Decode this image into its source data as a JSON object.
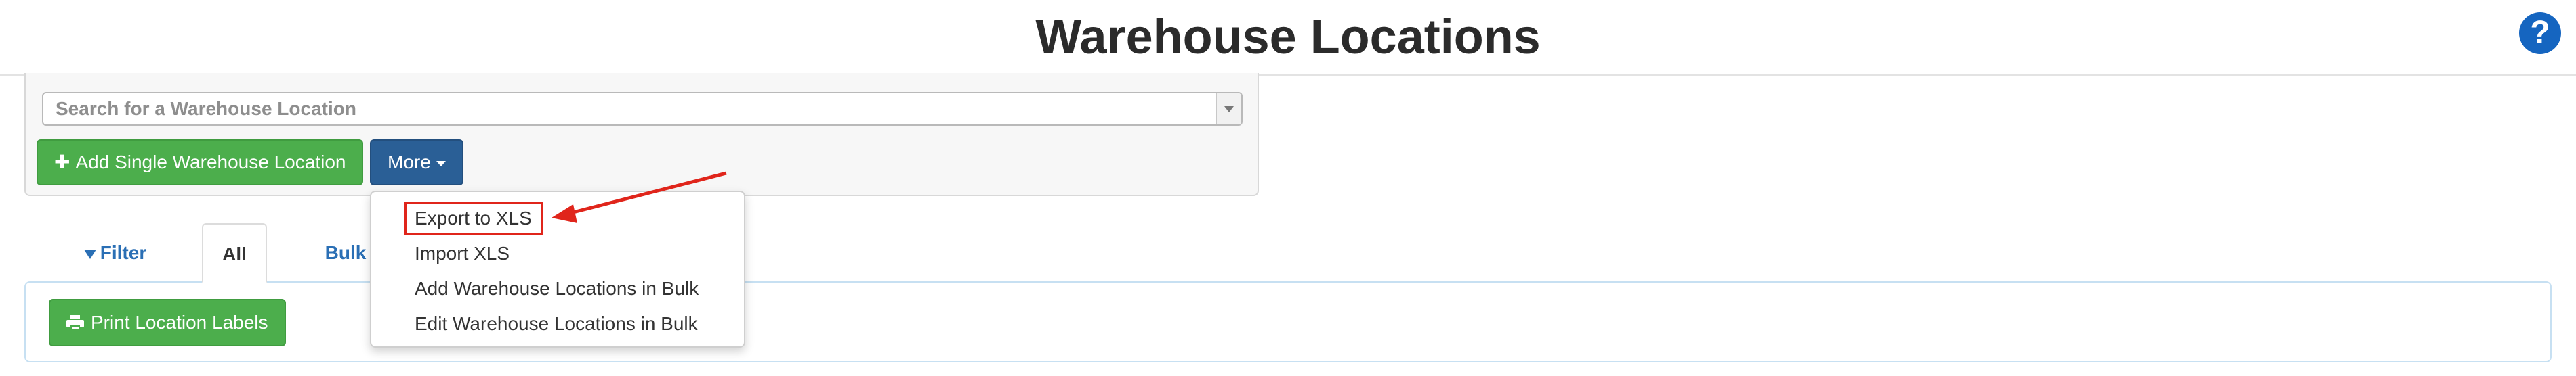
{
  "header": {
    "title": "Warehouse Locations",
    "help_glyph": "?"
  },
  "search": {
    "placeholder": "Search for a Warehouse Location",
    "value": ""
  },
  "toolbar": {
    "add_label": "Add Single Warehouse Location",
    "more_label": "More"
  },
  "tabs": [
    {
      "label": "Filter"
    },
    {
      "label": "All",
      "active": true
    },
    {
      "label": "Bulk"
    }
  ],
  "content": {
    "print_label": "Print Location Labels"
  },
  "dropdown": {
    "items": [
      {
        "label": "Export to XLS",
        "highlighted": true
      },
      {
        "label": "Import XLS"
      },
      {
        "label": "Add Warehouse Locations in Bulk"
      },
      {
        "label": "Edit Warehouse Locations in Bulk"
      }
    ]
  },
  "colors": {
    "primary_green": "#4cae4c",
    "primary_blue": "#2a5f96",
    "link_blue": "#2a6fb5",
    "help_blue": "#1565c0",
    "annotation_red": "#e0251b"
  },
  "icons": [
    "help-icon",
    "plus-icon",
    "caret-down-icon",
    "filter-icon",
    "printer-icon",
    "dropdown-arrow-icon"
  ]
}
